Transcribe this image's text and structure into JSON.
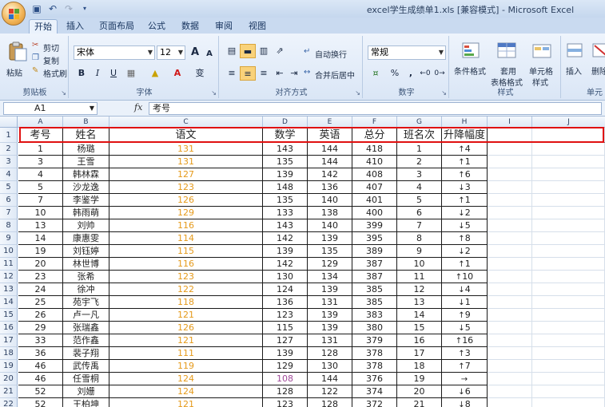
{
  "window": {
    "title": "excel学生成绩单1.xls  [兼容模式] - Microsoft Excel"
  },
  "ribbon_tabs": [
    "开始",
    "插入",
    "页面布局",
    "公式",
    "数据",
    "审阅",
    "视图"
  ],
  "active_tab": "开始",
  "clipboard": {
    "paste": "粘贴",
    "cut": "剪切",
    "copy": "复制",
    "format_painter": "格式刷",
    "group": "剪贴板"
  },
  "font": {
    "name": "宋体",
    "size": "12",
    "group": "字体",
    "bold": "B",
    "italic": "I",
    "underline": "U",
    "grow": "A",
    "shrink": "A",
    "phonetic": "变"
  },
  "alignment": {
    "wrap": "自动换行",
    "merge": "合并后居中",
    "group": "对齐方式"
  },
  "number": {
    "format": "常规",
    "group": "数字",
    "percent": "%",
    "comma": ","
  },
  "styles": {
    "conditional": "条件格式",
    "table_format_1": "套用",
    "table_format_2": "表格格式",
    "cell_styles_1": "单元格",
    "cell_styles_2": "样式",
    "group": "样式"
  },
  "cells": {
    "insert": "插入",
    "delete": "删除",
    "group": "单元"
  },
  "formula_bar": {
    "name_box": "A1",
    "fx": "fx",
    "content": "考号"
  },
  "columns": [
    "A",
    "B",
    "C",
    "D",
    "E",
    "F",
    "G",
    "H",
    "I",
    "J"
  ],
  "headers": [
    "考号",
    "姓名",
    "语文",
    "数学",
    "英语",
    "总分",
    "班名次",
    "升降幅度"
  ],
  "rows": [
    {
      "n": "2",
      "id": "1",
      "name": "杨璐",
      "chinese": "131",
      "math": "143",
      "english": "144",
      "total": "418",
      "rank": "1",
      "arrow": "↑",
      "delta": "4"
    },
    {
      "n": "3",
      "id": "3",
      "name": "王雪",
      "chinese": "131",
      "math": "135",
      "english": "144",
      "total": "410",
      "rank": "2",
      "arrow": "↑",
      "delta": "1"
    },
    {
      "n": "4",
      "id": "4",
      "name": "韩林霖",
      "chinese": "127",
      "math": "139",
      "english": "142",
      "total": "408",
      "rank": "3",
      "arrow": "↑",
      "delta": "6"
    },
    {
      "n": "5",
      "id": "5",
      "name": "沙龙逸",
      "chinese": "123",
      "math": "148",
      "english": "136",
      "total": "407",
      "rank": "4",
      "arrow": "↓",
      "delta": "3"
    },
    {
      "n": "6",
      "id": "7",
      "name": "李鉴学",
      "chinese": "126",
      "math": "135",
      "english": "140",
      "total": "401",
      "rank": "5",
      "arrow": "↑",
      "delta": "1"
    },
    {
      "n": "7",
      "id": "10",
      "name": "韩雨萌",
      "chinese": "129",
      "math": "133",
      "english": "138",
      "total": "400",
      "rank": "6",
      "arrow": "↓",
      "delta": "2"
    },
    {
      "n": "8",
      "id": "13",
      "name": "刘帅",
      "chinese": "116",
      "math": "143",
      "english": "140",
      "total": "399",
      "rank": "7",
      "arrow": "↓",
      "delta": "5"
    },
    {
      "n": "9",
      "id": "14",
      "name": "康惠雯",
      "chinese": "114",
      "math": "142",
      "english": "139",
      "total": "395",
      "rank": "8",
      "arrow": "↑",
      "delta": "8"
    },
    {
      "n": "10",
      "id": "19",
      "name": "刘钰婷",
      "chinese": "115",
      "math": "139",
      "english": "135",
      "total": "389",
      "rank": "9",
      "arrow": "↓",
      "delta": "2"
    },
    {
      "n": "11",
      "id": "20",
      "name": "林世博",
      "chinese": "116",
      "math": "142",
      "english": "129",
      "total": "387",
      "rank": "10",
      "arrow": "↑",
      "delta": "1"
    },
    {
      "n": "12",
      "id": "23",
      "name": "张希",
      "chinese": "123",
      "math": "130",
      "english": "134",
      "total": "387",
      "rank": "11",
      "arrow": "↑",
      "delta": "10"
    },
    {
      "n": "13",
      "id": "24",
      "name": "徐冲",
      "chinese": "122",
      "math": "124",
      "english": "139",
      "total": "385",
      "rank": "12",
      "arrow": "↓",
      "delta": "4"
    },
    {
      "n": "14",
      "id": "25",
      "name": "苑宇飞",
      "chinese": "118",
      "math": "136",
      "english": "131",
      "total": "385",
      "rank": "13",
      "arrow": "↓",
      "delta": "1"
    },
    {
      "n": "15",
      "id": "26",
      "name": "卢一凡",
      "chinese": "121",
      "math": "123",
      "english": "139",
      "total": "383",
      "rank": "14",
      "arrow": "↑",
      "delta": "9"
    },
    {
      "n": "16",
      "id": "29",
      "name": "张瑞鑫",
      "chinese": "126",
      "math": "115",
      "english": "139",
      "total": "380",
      "rank": "15",
      "arrow": "↓",
      "delta": "5"
    },
    {
      "n": "17",
      "id": "33",
      "name": "范作鑫",
      "chinese": "121",
      "math": "127",
      "english": "131",
      "total": "379",
      "rank": "16",
      "arrow": "↑",
      "delta": "16"
    },
    {
      "n": "18",
      "id": "36",
      "name": "裴子翔",
      "chinese": "111",
      "math": "139",
      "english": "128",
      "total": "378",
      "rank": "17",
      "arrow": "↑",
      "delta": "3"
    },
    {
      "n": "19",
      "id": "46",
      "name": "武传禹",
      "chinese": "119",
      "math": "129",
      "english": "130",
      "total": "378",
      "rank": "18",
      "arrow": "↑",
      "delta": "7"
    },
    {
      "n": "20",
      "id": "46",
      "name": "任雪桐",
      "chinese": "124",
      "math": "108",
      "english": "144",
      "total": "376",
      "rank": "19",
      "arrow": "→",
      "delta": ""
    },
    {
      "n": "21",
      "id": "52",
      "name": "刘姗",
      "chinese": "124",
      "math": "128",
      "english": "122",
      "total": "374",
      "rank": "20",
      "arrow": "↓",
      "delta": "6"
    },
    {
      "n": "22",
      "id": "52",
      "name": "王柏坤",
      "chinese": "121",
      "math": "123",
      "english": "128",
      "total": "372",
      "rank": "21",
      "arrow": "↓",
      "delta": "8"
    }
  ],
  "colors": {
    "chinese_score": "#e59a1b",
    "low_score": "#a04a9a",
    "highlight_border": "#e01010"
  }
}
